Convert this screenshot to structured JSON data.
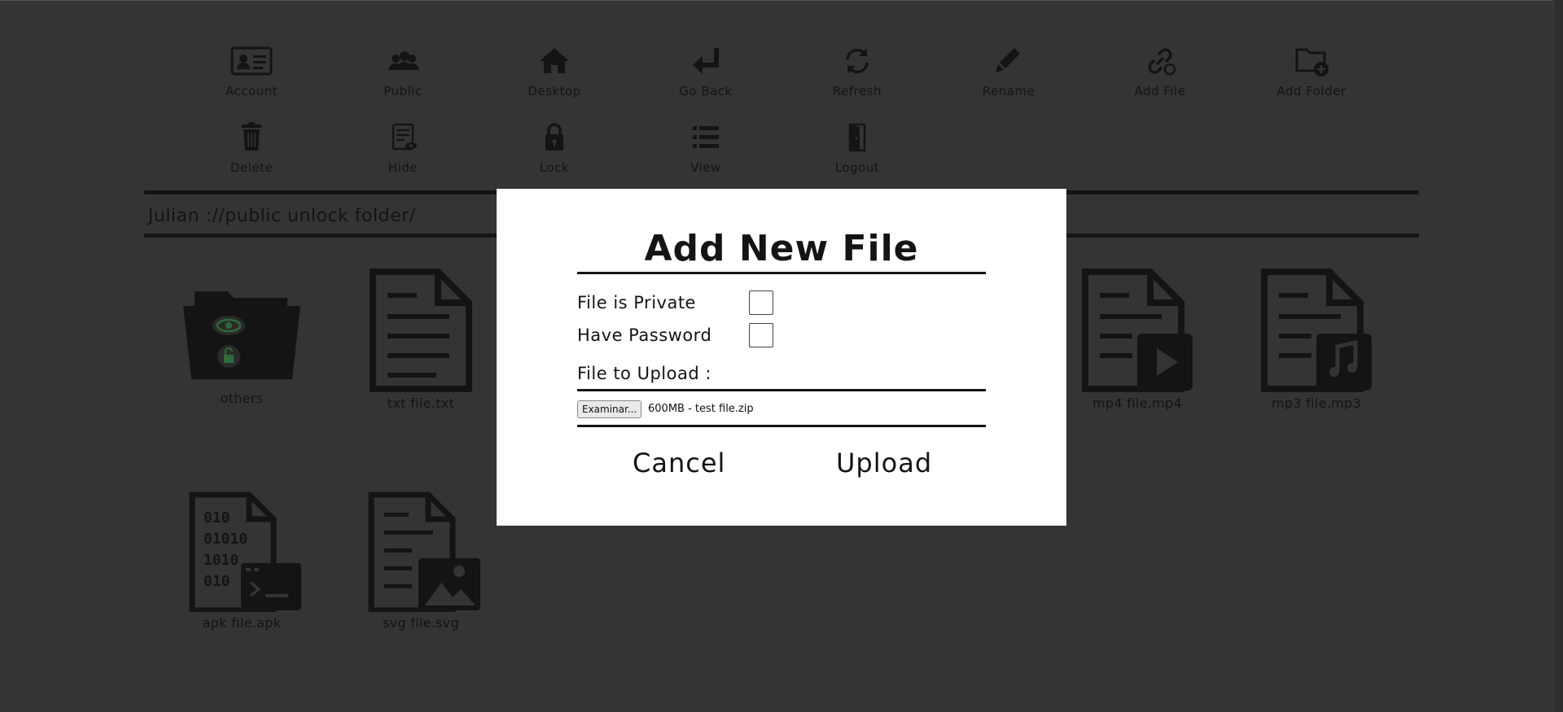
{
  "toolbar": {
    "row1": [
      "Account",
      "Public",
      "Desktop",
      "Go Back",
      "Refresh",
      "Rename",
      "Add File",
      "Add Folder"
    ],
    "row2": [
      "Delete",
      "Hide",
      "Lock",
      "View",
      "Logout"
    ]
  },
  "path": "Julian ://public unlock folder/",
  "files": [
    "others",
    "txt file.txt",
    "mp4 file.mp4",
    "mp3 file.mp3",
    "apk file.apk",
    "svg file.svg"
  ],
  "dialog": {
    "title": "Add New File",
    "private_label": "File is Private",
    "password_label": "Have Password",
    "upload_label": "File to Upload :",
    "browse_label": "Examinar...",
    "selected_file": "600MB - test file.zip",
    "cancel_label": "Cancel",
    "upload_button": "Upload"
  },
  "colors": {
    "background": "#343434",
    "icon": "#141414",
    "dialog": "#ffffff",
    "folder_accent": "#2e6b3a"
  }
}
